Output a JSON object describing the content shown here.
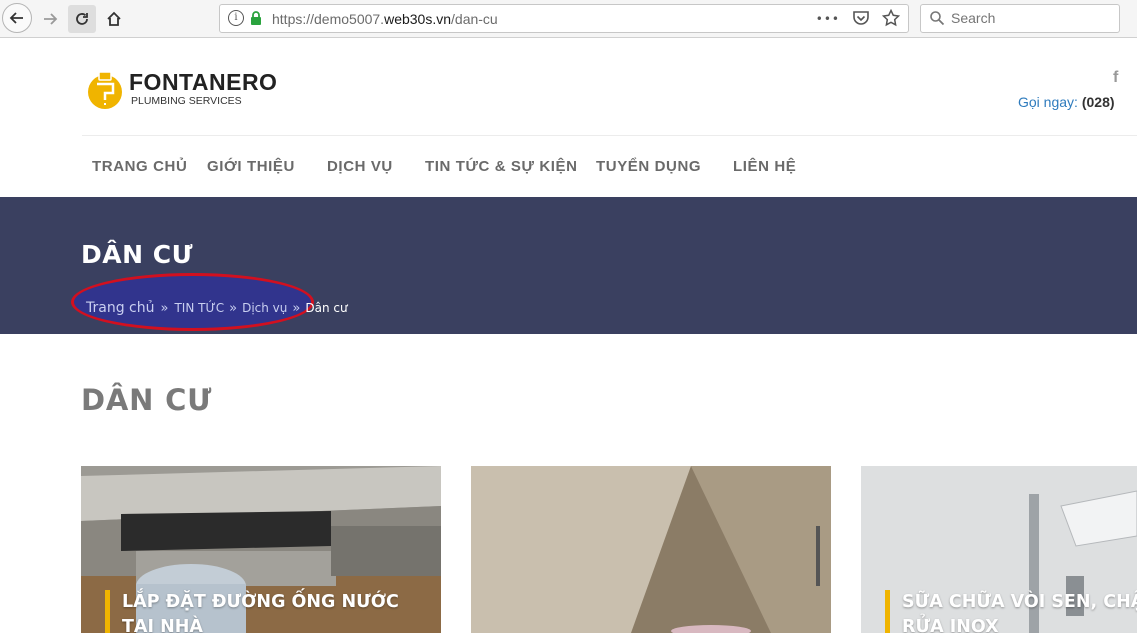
{
  "browser": {
    "url_prefix": "https://demo5007.",
    "url_host": "web30s.vn",
    "url_path": "/dan-cu",
    "search_placeholder": "Search",
    "more_glyph": "•••"
  },
  "header": {
    "logo_name": "FONTANERO",
    "logo_tagline": "PLUMBING SERVICES",
    "social_facebook": "f",
    "hotline_label": "Gọi ngay:",
    "hotline_number": "(028)",
    "brand_color": "#f0b400"
  },
  "nav": {
    "items": [
      {
        "label": "TRANG CHỦ"
      },
      {
        "label": "GIỚI THIỆU"
      },
      {
        "label": "DỊCH VỤ"
      },
      {
        "label": "TIN TỨC & SỰ KIỆN"
      },
      {
        "label": "TUYỂN DỤNG"
      },
      {
        "label": "LIÊN HỆ"
      }
    ]
  },
  "banner": {
    "title": "DÂN CƯ",
    "background": "#3a4060",
    "breadcrumb": {
      "home": "Trang chủ",
      "separator": "»",
      "news": "TIN TỨC",
      "services": "Dịch vụ",
      "current": "Dân cư"
    },
    "highlight_color": "#d2101f"
  },
  "content": {
    "title": "DÂN CƯ",
    "cards": [
      {
        "caption_line1": "LẮP ĐẶT ĐƯỜNG ỐNG NƯỚC",
        "caption_line2": "TẠI NHÀ"
      },
      {
        "caption_line1": "",
        "caption_line2": ""
      },
      {
        "caption_line1": "SỮA CHỮA VÒI SEN, CHẬU",
        "caption_line2": "RỬA INOX"
      }
    ]
  }
}
